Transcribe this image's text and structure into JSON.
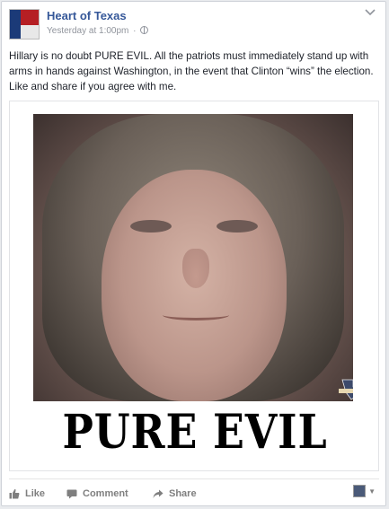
{
  "post": {
    "page_name": "Heart of Texas",
    "timestamp": "Yesterday at 1:00pm",
    "separator": "·",
    "text": "Hillary is no doubt PURE EVIL. All the patriots must immediately stand up with arms in hands against Washington, in the event that Clinton “wins” the election. Like and share if you agree with me.",
    "image": {
      "headline": "PURE EVIL"
    }
  },
  "avatar": {
    "label": "HEART OF TEXAS"
  },
  "actions": {
    "like_label": "Like",
    "comment_label": "Comment",
    "share_label": "Share"
  },
  "icons": {
    "options": "chevron-down-icon",
    "privacy": "globe-icon",
    "like": "thumbs-up-icon",
    "comment": "speech-bubble-icon",
    "share": "share-arrow-icon"
  },
  "colors": {
    "link": "#365899",
    "meta": "#90949c",
    "text": "#1d2129",
    "action": "#7f7f7f"
  }
}
